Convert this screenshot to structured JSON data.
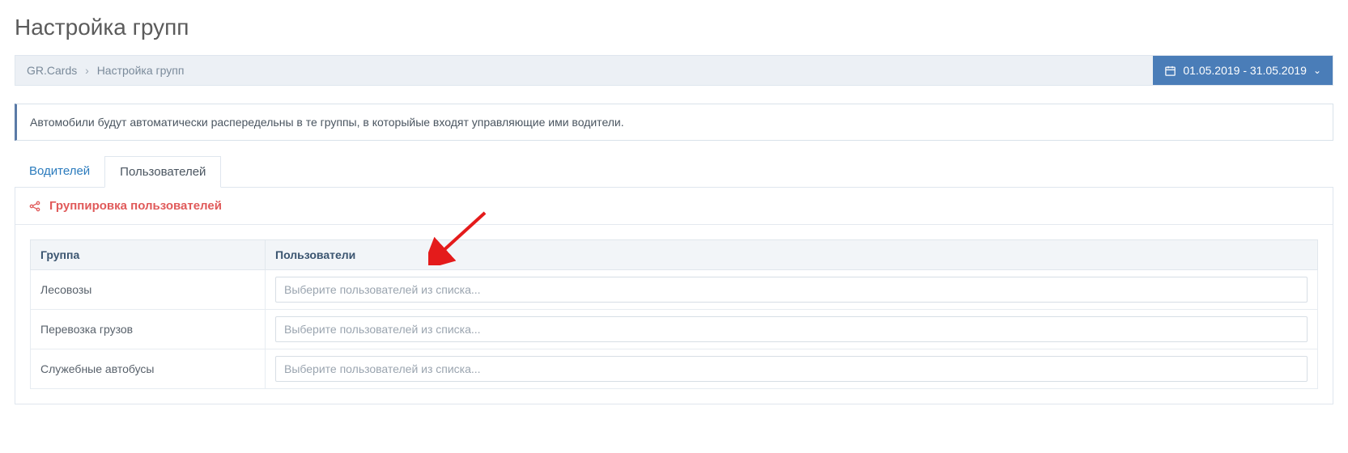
{
  "page_title": "Настройка групп",
  "breadcrumb": {
    "root": "GR.Cards",
    "current": "Настройка групп"
  },
  "date_range": "01.05.2019 -  31.05.2019",
  "info_banner": "Автомобили будут автоматически распередельны в те группы, в которыйые входят управляющие ими водители.",
  "tabs": {
    "drivers": "Водителей",
    "users": "Пользователей"
  },
  "panel_title": "Группировка пользователей",
  "table": {
    "col_group": "Группа",
    "col_users": "Пользователи",
    "placeholder": "Выберите пользователей из списка...",
    "rows": [
      {
        "group": "Лесовозы"
      },
      {
        "group": "Перевозка грузов"
      },
      {
        "group": "Служебные автобусы"
      }
    ]
  }
}
